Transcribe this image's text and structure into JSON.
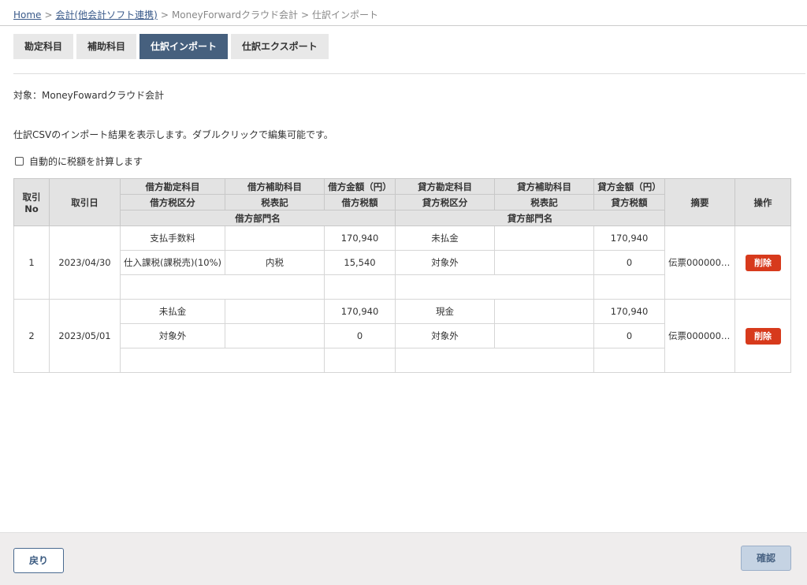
{
  "breadcrumb": {
    "home": "Home",
    "accounting": "会計(他会計ソフト連携)",
    "software": "MoneyForwardクラウド会計",
    "current": "仕訳インポート",
    "separator": ">"
  },
  "tabs": [
    {
      "label": "勘定科目",
      "active": false
    },
    {
      "label": "補助科目",
      "active": false
    },
    {
      "label": "仕訳インポート",
      "active": true
    },
    {
      "label": "仕訳エクスポート",
      "active": false
    }
  ],
  "target_label": "対象：MoneyFowardクラウド会計",
  "description": "仕訳CSVのインポート結果を表示します。ダブルクリックで編集可能です。",
  "auto_tax": {
    "label": "自動的に税額を計算します",
    "checked": false
  },
  "table": {
    "headers": {
      "no_line1": "取引",
      "no_line2": "No",
      "date": "取引日",
      "debit_account": "借方勘定科目",
      "debit_sub": "借方補助科目",
      "debit_amount": "借方金額（円）",
      "credit_account": "貸方勘定科目",
      "credit_sub": "貸方補助科目",
      "credit_amount": "貸方金額（円）",
      "memo": "摘要",
      "action": "操作",
      "debit_tax_class": "借方税区分",
      "debit_tax_notation": "税表記",
      "debit_tax": "借方税額",
      "credit_tax_class": "貸方税区分",
      "credit_tax_notation": "税表記",
      "credit_tax": "貸方税額",
      "debit_dept": "借方部門名",
      "credit_dept": "貸方部門名"
    },
    "rows": [
      {
        "no": "1",
        "date": "2023/04/30",
        "debit_account": "支払手数料",
        "debit_sub": "",
        "debit_amount": "170,940",
        "credit_account": "未払金",
        "credit_sub": "",
        "credit_amount": "170,940",
        "debit_tax_class": "仕入課税(課税売)(10%)",
        "debit_tax_notation": "内税",
        "debit_tax": "15,540",
        "credit_tax_class": "対象外",
        "credit_tax_notation": "",
        "credit_tax": "0",
        "debit_dept": "",
        "credit_dept": "",
        "memo": "伝票0000000…",
        "delete_label": "削除"
      },
      {
        "no": "2",
        "date": "2023/05/01",
        "debit_account": "未払金",
        "debit_sub": "",
        "debit_amount": "170,940",
        "credit_account": "現金",
        "credit_sub": "",
        "credit_amount": "170,940",
        "debit_tax_class": "対象外",
        "debit_tax_notation": "",
        "debit_tax": "0",
        "credit_tax_class": "対象外",
        "credit_tax_notation": "",
        "credit_tax": "0",
        "debit_dept": "",
        "credit_dept": "",
        "memo": "伝票0000000…",
        "delete_label": "削除"
      }
    ]
  },
  "footer": {
    "back_label": "戻り",
    "confirm_label": "確認"
  },
  "colors": {
    "tab_active": "#46607e",
    "delete": "#d73a1c",
    "confirm": "#c5d3e3"
  }
}
